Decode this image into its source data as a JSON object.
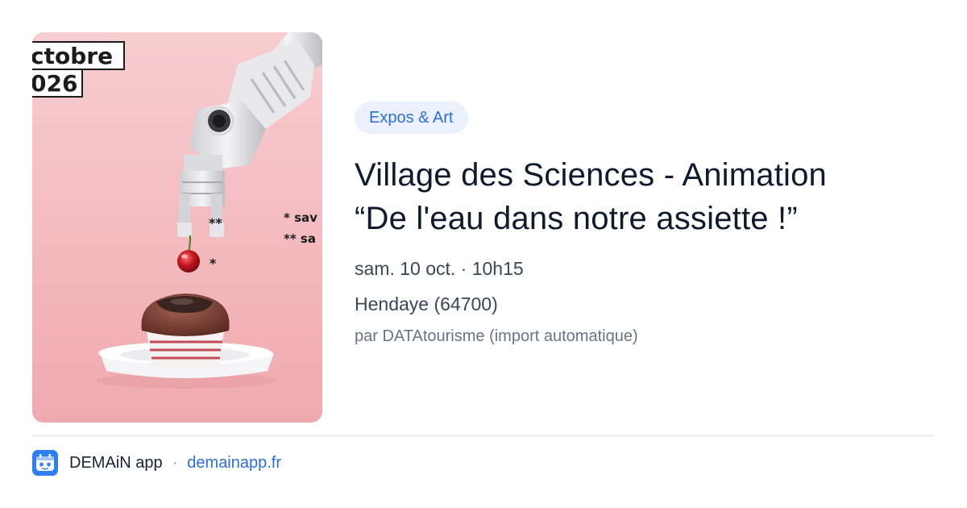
{
  "poster": {
    "month_fragment": "ctobre",
    "year_fragment": "026",
    "note_1_mark": "*",
    "note_2_mark": "**",
    "note_1_text": "* sav",
    "note_2_text": "** sa"
  },
  "event": {
    "category": "Expos & Art",
    "title_line_1": "Village des Sciences - Animation",
    "title_line_2": "“De l'eau dans notre assiette !”",
    "datetime": "sam. 10 oct. · 10h15",
    "location": "Hendaye (64700)",
    "source": "par DATAtourisme (import automatique)"
  },
  "footer": {
    "app_name": "DEMAiN app",
    "separator": "·",
    "domain": "demainapp.fr",
    "icon": "demain-app-icon"
  },
  "colors": {
    "accent": "#2f6fd0",
    "badge_bg": "#eaf1fb",
    "poster_pink": "#f2b4b8"
  }
}
